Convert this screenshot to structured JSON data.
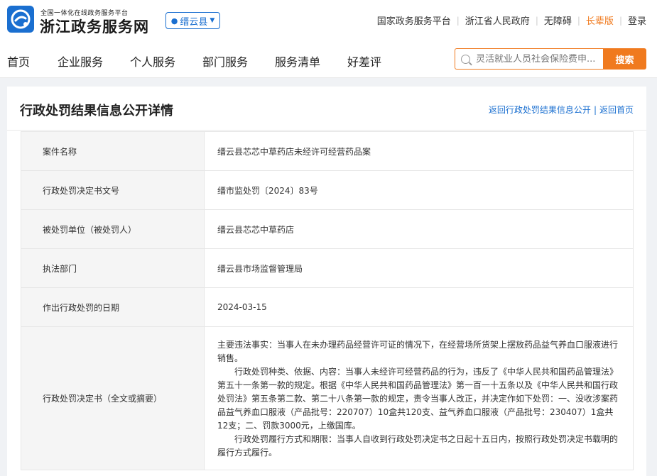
{
  "header": {
    "subtitle": "全国一体化在线政务服务平台",
    "site_title": "浙江政务服务网",
    "region": "缙云县",
    "links": [
      "国家政务服务平台",
      "浙江省人民政府",
      "无障碍",
      "长辈版",
      "登录"
    ]
  },
  "nav": {
    "items": [
      "首页",
      "企业服务",
      "个人服务",
      "部门服务",
      "服务清单",
      "好差评"
    ],
    "search_placeholder": "灵活就业人员社会保险费申...",
    "search_button": "搜索"
  },
  "page": {
    "title": "行政处罚结果信息公开详情",
    "back_links": [
      "返回行政处罚结果信息公开",
      "返回首页"
    ]
  },
  "detail": [
    {
      "label": "案件名称",
      "value": "缙云县芯芯中草药店未经许可经营药品案"
    },
    {
      "label": "行政处罚决定书文号",
      "value": "缙市监处罚〔2024〕83号"
    },
    {
      "label": "被处罚单位（被处罚人）",
      "value": "缙云县芯芯中草药店"
    },
    {
      "label": "执法部门",
      "value": "缙云县市场监督管理局"
    },
    {
      "label": "作出行政处罚的日期",
      "value": "2024-03-15"
    },
    {
      "label": "行政处罚决定书（全文或摘要）",
      "paragraphs": [
        "主要违法事实：当事人在未办理药品经营许可证的情况下，在经营场所货架上摆放药品益气养血口服液进行销售。",
        "行政处罚种类、依据、内容：当事人未经许可经营药品的行为，违反了《中华人民共和国药品管理法》第五十一条第一款的规定。根据《中华人民共和国药品管理法》第一百一十五条以及《中华人民共和国行政处罚法》第五条第二款、第二十八条第一款的规定，责令当事人改正，并决定作如下处罚：一、没收涉案药品益气养血口服液（产品批号：220707）10盒共120支、益气养血口服液（产品批号：230407）1盒共12支；二、罚款3000元，上缴国库。",
        "行政处罚履行方式和期限：当事人自收到行政处罚决定书之日起十五日内，按照行政处罚决定书载明的履行方式履行。"
      ]
    }
  ],
  "colors": {
    "brand_blue": "#1a6fd0",
    "accent_orange": "#f07a1e"
  }
}
